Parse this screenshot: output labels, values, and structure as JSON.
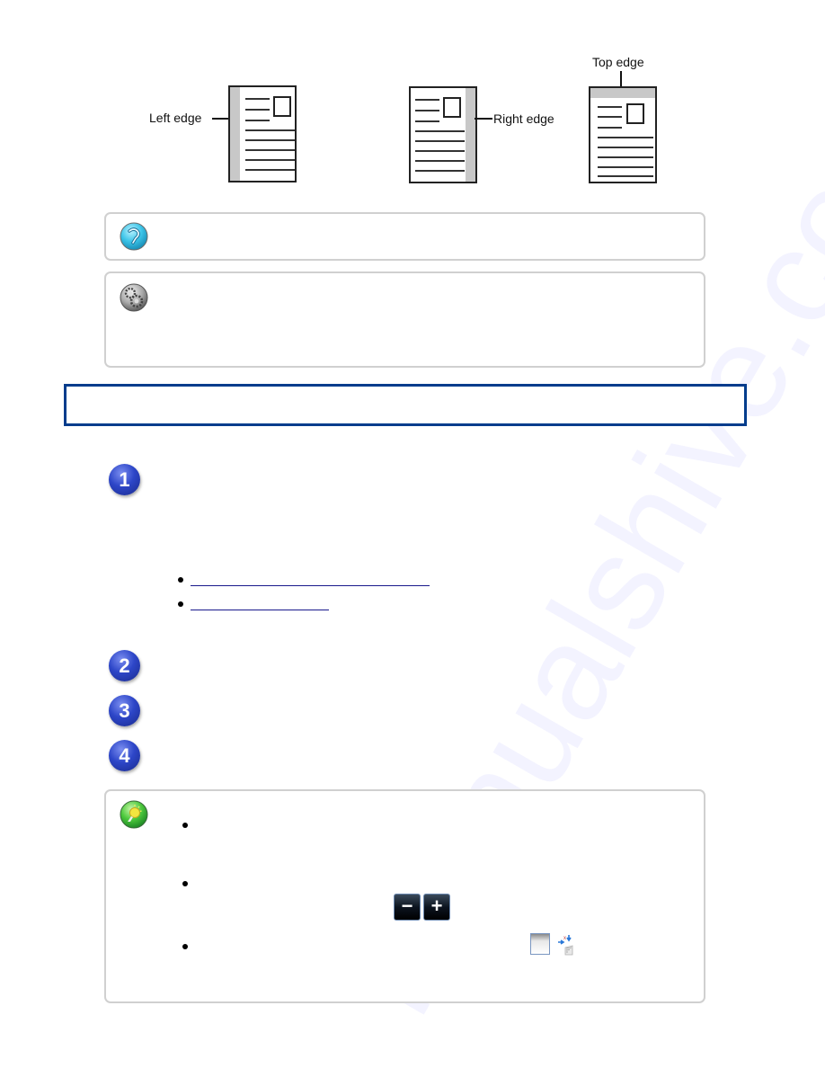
{
  "diagram": {
    "labels": {
      "left_edge": "Left edge",
      "right_edge": "Right edge",
      "top_edge": "Top edge"
    }
  },
  "hint_box": {
    "icon": "return-arrow-icon",
    "text": ""
  },
  "settings_box": {
    "icon": "gears-icon",
    "text": ""
  },
  "section_header": {
    "text": ""
  },
  "steps": [
    {
      "number": "1",
      "text": ""
    },
    {
      "number": "2",
      "text": ""
    },
    {
      "number": "3",
      "text": ""
    },
    {
      "number": "4",
      "text": ""
    }
  ],
  "step1_links": [
    {
      "label": ""
    },
    {
      "label": ""
    }
  ],
  "note_box": {
    "icon": "lightbulb-icon",
    "items": [
      {
        "text": ""
      },
      {
        "text": ""
      },
      {
        "text": ""
      }
    ],
    "zoom_out_symbol": "−",
    "zoom_in_symbol": "+"
  },
  "watermark": "manualshive.com"
}
